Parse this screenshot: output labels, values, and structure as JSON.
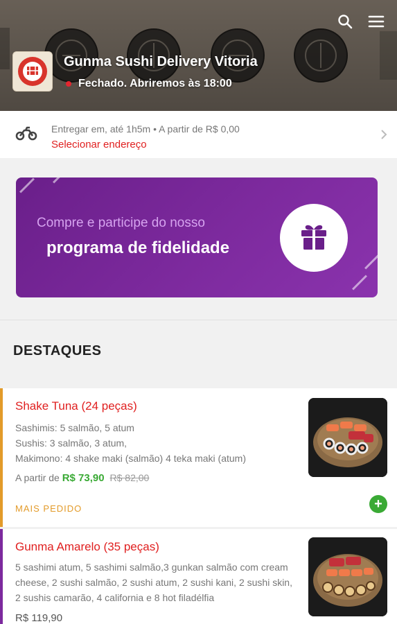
{
  "store": {
    "name": "Gunma Sushi Delivery Vitoria",
    "status": "Fechado. Abriremos às 18:00"
  },
  "header": {
    "icons": [
      "search-icon",
      "menu-icon"
    ]
  },
  "delivery": {
    "info": "Entregar em, até 1h5m  •  A partir de R$ 0,00",
    "address_link": "Selecionar endereço"
  },
  "loyalty_banner": {
    "line1": "Compre e participe do nosso",
    "line2": "programa de fidelidade"
  },
  "section": {
    "title": "DESTAQUES"
  },
  "products": [
    {
      "name": "Shake Tuna (24 peças)",
      "description_lines": [
        "Sashimis: 5 salmão, 5 atum",
        "Sushis: 3 salmão, 3 atum,",
        "Makimono: 4 shake maki (salmão) 4 teka maki (atum)"
      ],
      "price_prefix": "A partir de",
      "price": "R$ 73,90",
      "old_price": "R$ 82,00",
      "tag": "MAIS PEDIDO",
      "accent_color": "#e39b2a"
    },
    {
      "name": "Gunma Amarelo (35 peças)",
      "description": "5 sashimi atum, 5 sashimi salmão,3 gunkan salmão com cream cheese, 2 sushi salmão, 2 sushi atum, 2 sushi kani, 2 sushi skin, 2 sushis camarão, 4 california e 8 hot filadélfia",
      "price": "R$ 119,90",
      "accent_color": "#7d2a9e"
    }
  ],
  "colors": {
    "brand_red": "#e02020",
    "purple": "#7d2a9e",
    "green": "#3aaa35",
    "orange": "#e39b2a"
  }
}
